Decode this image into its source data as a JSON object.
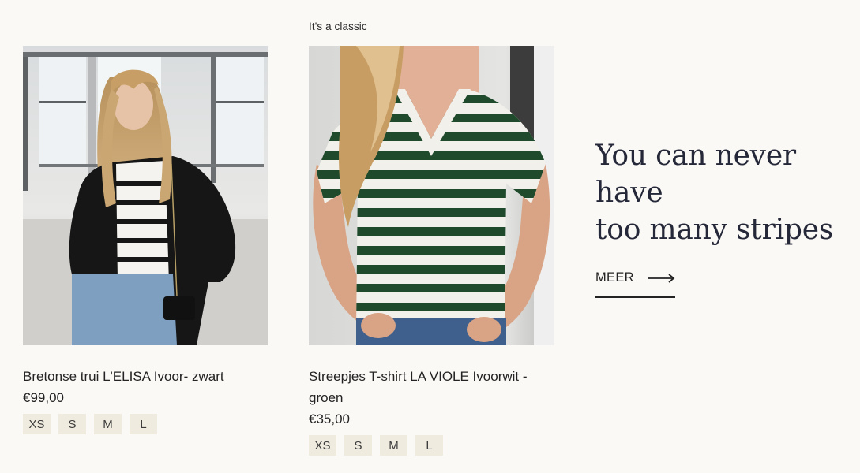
{
  "section": {
    "eyebrow": "It's a classic",
    "headline_line1": "You can never have",
    "headline_line2": "too many stripes",
    "more_label": "MEER",
    "more_icon": "arrow-right-icon"
  },
  "products": [
    {
      "title": "Bretonse trui L'ELISA Ivoor- zwart",
      "price": "€99,00",
      "sizes": [
        "XS",
        "S",
        "M",
        "L"
      ],
      "image": "woman-black-cardigan-striped-top"
    },
    {
      "title": "Streepjes T-shirt LA VIOLE Ivoorwit - groen",
      "price": "€35,00",
      "sizes": [
        "XS",
        "S",
        "M",
        "L"
      ],
      "image": "woman-green-striped-tshirt"
    }
  ],
  "colors": {
    "background": "#fbf9f6",
    "size_chip": "#f0ebdf",
    "text": "#232323",
    "stripe_green": "#1f4a2c"
  }
}
